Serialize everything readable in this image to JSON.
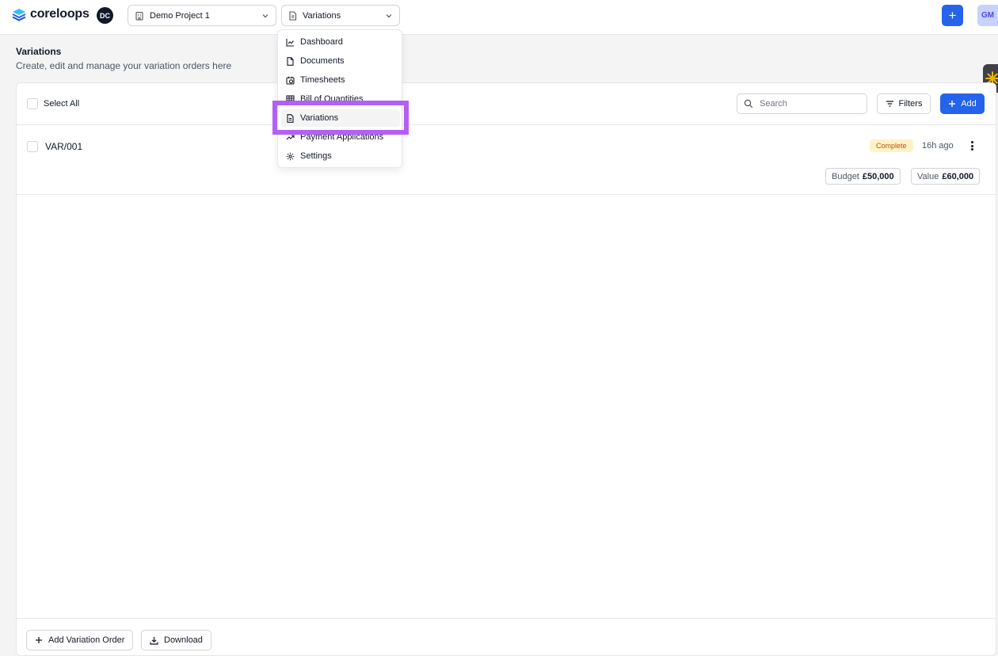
{
  "app": {
    "logo_text": "coreloops",
    "org_initials": "DC",
    "user_initials": "GM",
    "accent": "#2563eb",
    "highlight_color": "#b45ff5"
  },
  "header": {
    "project_select": {
      "value": "Demo Project 1",
      "icon": "building-icon"
    },
    "module_select": {
      "value": "Variations",
      "icon": "file-text-icon"
    },
    "plus_label": "+"
  },
  "page": {
    "title": "Variations",
    "subtitle": "Create, edit and manage your variation orders here"
  },
  "toolbar": {
    "select_all_label": "Select All",
    "search_placeholder": "Search",
    "filters_label": "Filters",
    "add_label": "Add"
  },
  "variations": [
    {
      "id": "VAR/001",
      "status": "Complete",
      "time": "16h ago",
      "budget_label": "Budget",
      "budget_value": "£50,000",
      "value_label": "Value",
      "value_value": "£60,000"
    }
  ],
  "footer": {
    "add_variation_label": "Add Variation Order",
    "download_label": "Download"
  },
  "module_menu": {
    "items": [
      {
        "label": "Dashboard",
        "icon": "chart-line-icon"
      },
      {
        "label": "Documents",
        "icon": "file-icon"
      },
      {
        "label": "Timesheets",
        "icon": "calendar-clock-icon"
      },
      {
        "label": "Bill of Quantities",
        "icon": "table-icon"
      },
      {
        "label": "Variations",
        "icon": "file-text-icon",
        "active": true
      },
      {
        "label": "Payment Applications",
        "icon": "trending-up-icon"
      },
      {
        "label": "Settings",
        "icon": "gear-icon"
      }
    ]
  }
}
